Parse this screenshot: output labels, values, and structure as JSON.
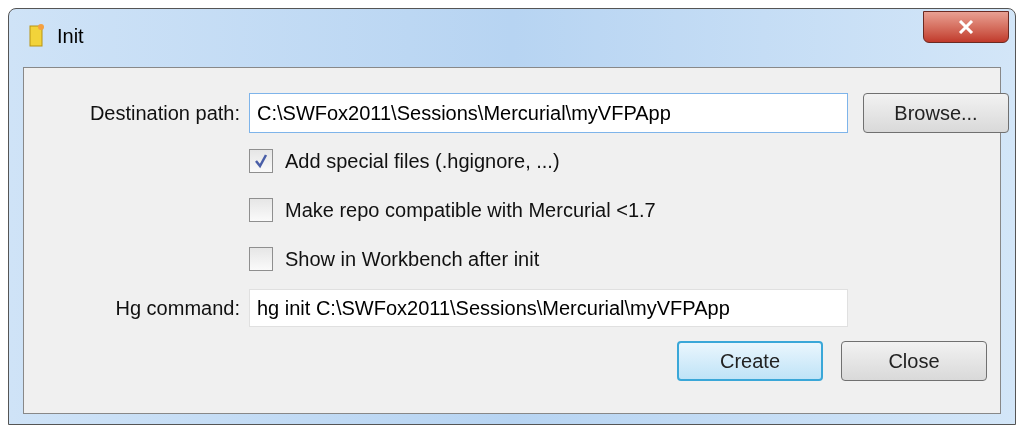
{
  "window": {
    "title": "Init"
  },
  "destination": {
    "label": "Destination path:",
    "value": "C:\\SWFox2011\\Sessions\\Mercurial\\myVFPApp"
  },
  "browse_button": "Browse...",
  "options": [
    {
      "label": "Add special files (.hgignore, ...)",
      "checked": true
    },
    {
      "label": "Make repo compatible with Mercurial <1.7",
      "checked": false
    },
    {
      "label": "Show in Workbench after init",
      "checked": false
    }
  ],
  "command": {
    "label": "Hg command:",
    "value": "hg init C:\\SWFox2011\\Sessions\\Mercurial\\myVFPApp"
  },
  "buttons": [
    {
      "label": "Create",
      "default": true
    },
    {
      "label": "Close",
      "default": false
    }
  ]
}
